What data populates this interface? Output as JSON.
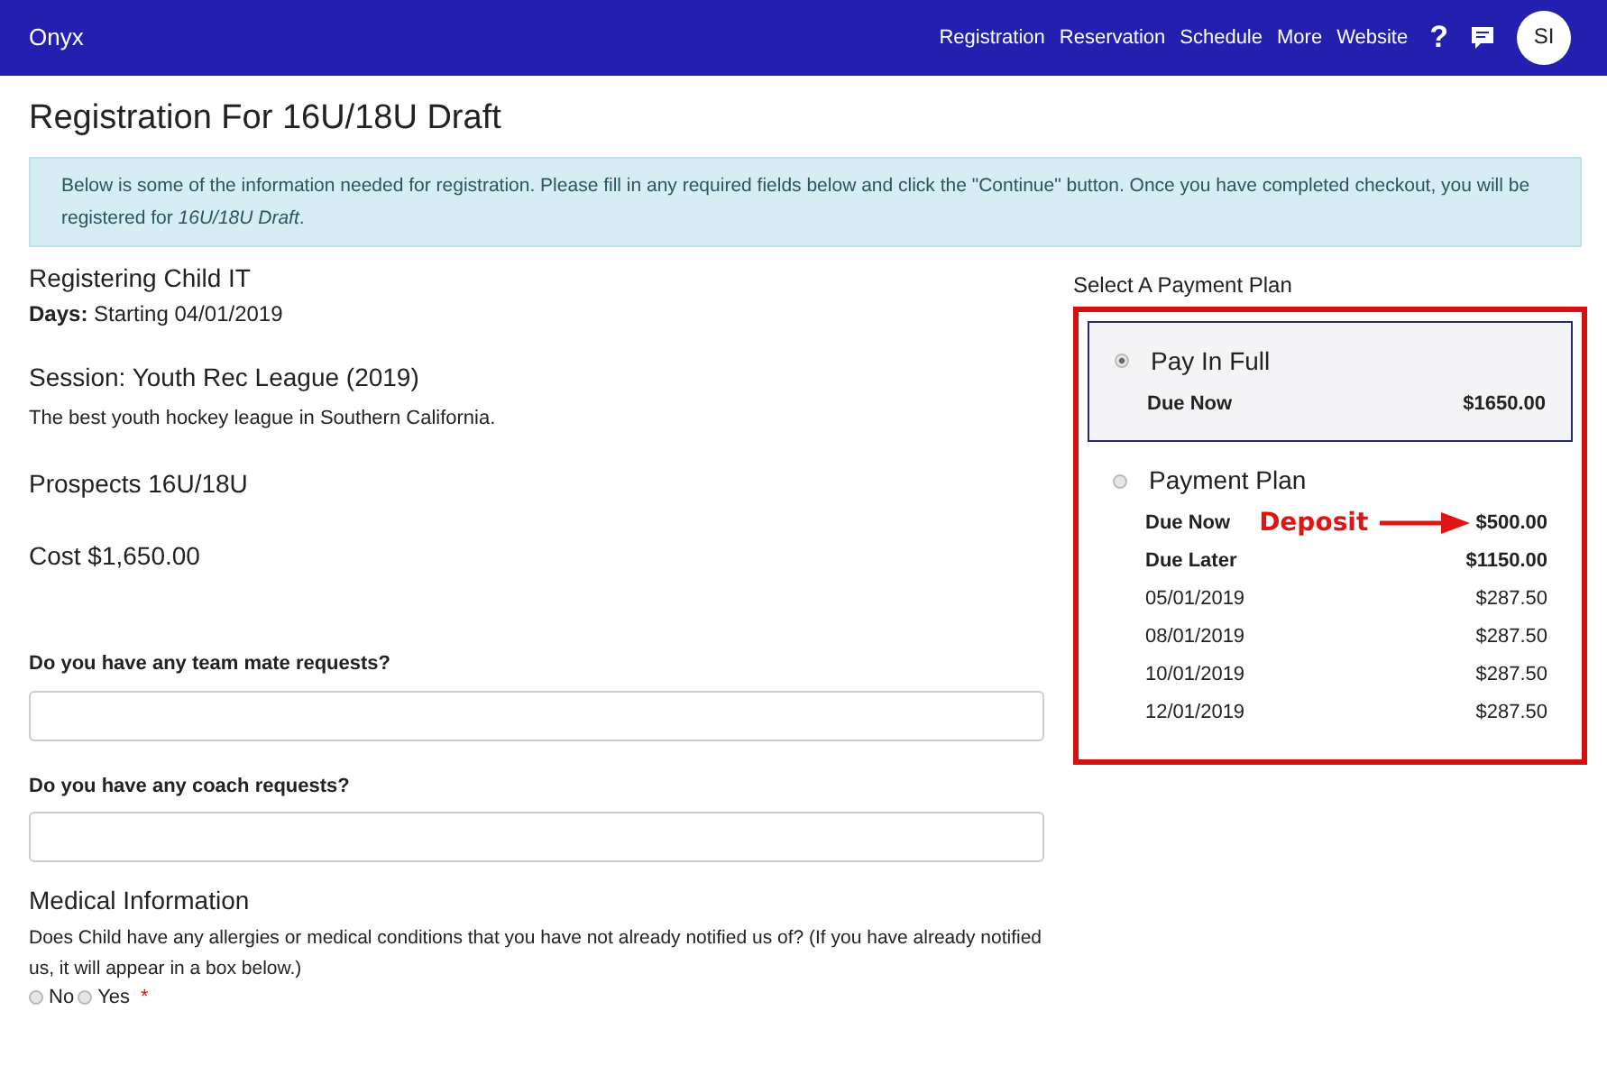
{
  "navbar": {
    "brand": "Onyx",
    "links": [
      "Registration",
      "Reservation",
      "Schedule",
      "More",
      "Website"
    ],
    "help": "?",
    "avatar": "SI"
  },
  "page_title": "Registration For 16U/18U Draft",
  "notice": "Below is some of the information needed for registration. Please fill in any required fields below and click the \"Continue\" button. Once you have completed checkout, you will be registered for *16U/18U Draft*.",
  "details": {
    "child": "Registering Child IT",
    "days_label": "Days:",
    "days_value": "Starting 04/01/2019",
    "session": "Session: Youth Rec League (2019)",
    "session_description": "The best youth hockey league in Southern California.",
    "program": "Prospects 16U/18U",
    "cost": "Cost $1,650.00"
  },
  "questions": [
    {
      "label": "Do you have any team mate requests?"
    },
    {
      "label": "Do you have any coach requests?"
    }
  ],
  "medical": {
    "heading": "Medical Information",
    "question": "Does Child have any allergies or medical conditions that you have not already notified us of? (If you have already notified us, it will appear in a box below.)",
    "options": [
      {
        "label": "No",
        "selected": false
      },
      {
        "label": "Yes",
        "selected": false
      }
    ],
    "required_mark": "*"
  },
  "payment": {
    "heading": "Select A Payment Plan",
    "annotation": "Deposit",
    "plans": [
      {
        "name": "Pay In Full",
        "selected": true,
        "rows": [
          {
            "label": "Due Now",
            "amount": "$1650.00",
            "bold": true
          }
        ]
      },
      {
        "name": "Payment Plan",
        "selected": false,
        "rows": [
          {
            "label": "Due Now",
            "amount": "$500.00",
            "bold": true,
            "annotated": true
          },
          {
            "label": "Due Later",
            "amount": "$1150.00",
            "bold": true
          },
          {
            "label": "05/01/2019",
            "amount": "$287.50",
            "bold": false
          },
          {
            "label": "08/01/2019",
            "amount": "$287.50",
            "bold": false
          },
          {
            "label": "10/01/2019",
            "amount": "$287.50",
            "bold": false
          },
          {
            "label": "12/01/2019",
            "amount": "$287.50",
            "bold": false
          }
        ]
      }
    ]
  }
}
